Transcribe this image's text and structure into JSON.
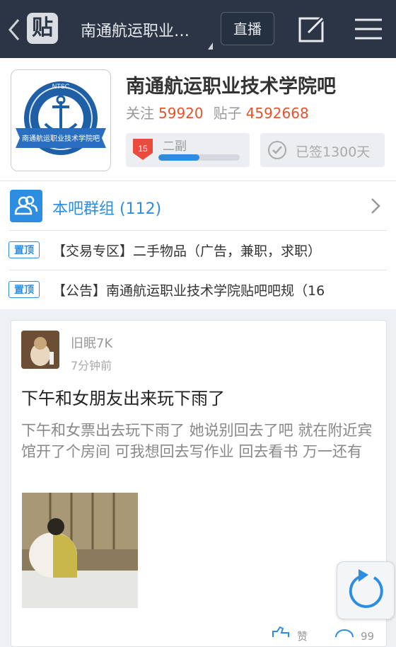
{
  "topbar": {
    "forum_name": "南通航运职业技术学院吧",
    "logo_char": "贴",
    "live_label": "直播"
  },
  "forum": {
    "title": "南通航运职业技术学院吧",
    "follow_label": "关注",
    "follow_count": "59920",
    "posts_label": "贴子",
    "posts_count": "4592668",
    "emblem_text": "NTSC",
    "emblem_banner": "南通航运职业技术学院吧",
    "level": "15",
    "level_title": "二副",
    "level_progress": 0.5,
    "sign_text": "已签1300天"
  },
  "group": {
    "label": "本吧群组 (112)"
  },
  "pinned": [
    {
      "tag": "置顶",
      "text": "【交易专区】二手物品（广告，兼职，求职）"
    },
    {
      "tag": "置顶",
      "text": "【公告】南通航运职业技术学院贴吧吧规（16"
    }
  ],
  "post": {
    "user": "旧眠7K",
    "time": "7分钟前",
    "title": "下午和女朋友出来玩下雨了",
    "body": "下午和女票出去玩下雨了 她说别回去了吧 就在附近宾馆开了个房间 可我想回去写作业 回去看书 万一还有",
    "like_label": "赞",
    "comment_count": "99"
  },
  "colors": {
    "topbar": "#2b3545",
    "accent_blue": "#2d8de0",
    "count_orange": "#e2552a"
  }
}
